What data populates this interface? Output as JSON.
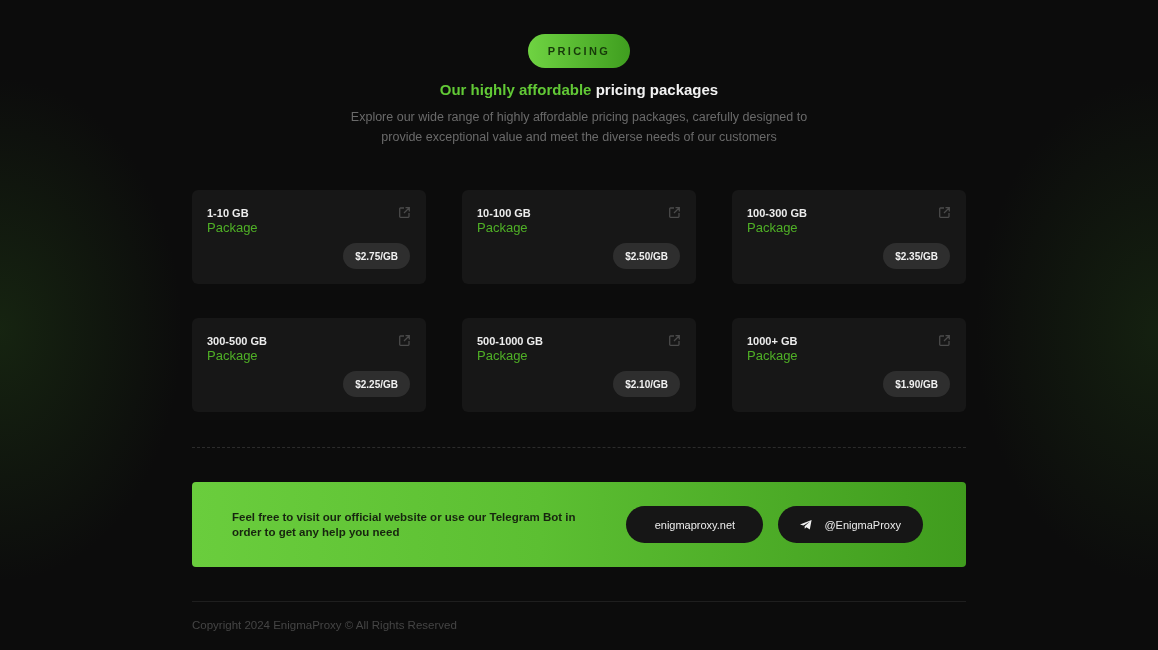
{
  "section_tag": "PRICING",
  "heading": {
    "highlight": "Our highly affordable",
    "rest": "pricing packages"
  },
  "subtitle": "Explore our wide range of highly affordable pricing packages, carefully designed to provide exceptional value and meet the diverse needs of our customers",
  "packages": [
    {
      "size": "1-10 GB",
      "label": "Package",
      "price": "$2.75/GB"
    },
    {
      "size": "10-100 GB",
      "label": "Package",
      "price": "$2.50/GB"
    },
    {
      "size": "100-300 GB",
      "label": "Package",
      "price": "$2.35/GB"
    },
    {
      "size": "300-500 GB",
      "label": "Package",
      "price": "$2.25/GB"
    },
    {
      "size": "500-1000 GB",
      "label": "Package",
      "price": "$2.10/GB"
    },
    {
      "size": "1000+ GB",
      "label": "Package",
      "price": "$1.90/GB"
    }
  ],
  "contact": {
    "text": "Feel free to visit our official website or use our Telegram Bot in order to get any help you need",
    "links": [
      {
        "kind": "website",
        "label": "enigmaproxy.net"
      },
      {
        "kind": "telegram",
        "label": "@EnigmaProxy"
      }
    ]
  },
  "footer": {
    "copyright": "Copyright 2024 EnigmaProxy © All Rights Reserved"
  }
}
